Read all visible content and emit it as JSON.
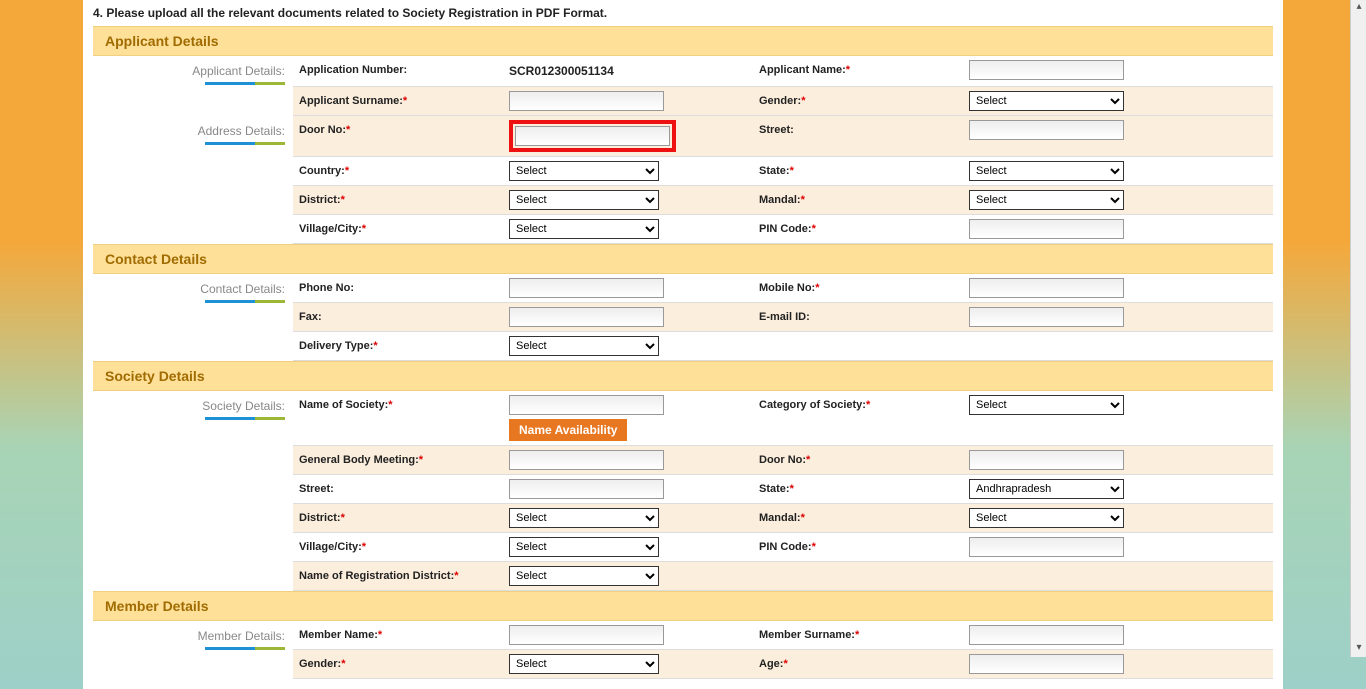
{
  "instruction": "4. Please upload all the relevant documents related to Society Registration in PDF Format.",
  "sections": {
    "applicant": {
      "title": "Applicant Details",
      "sidebars": {
        "applicant": "Applicant Details:",
        "address": "Address Details:"
      },
      "fields": {
        "application_number_label": "Application Number:",
        "application_number_value": "SCR012300051134",
        "applicant_name_label": "Applicant Name:",
        "applicant_surname_label": "Applicant Surname:",
        "gender_label": "Gender:",
        "door_no_label": "Door No:",
        "street_label": "Street:",
        "country_label": "Country:",
        "state_label": "State:",
        "district_label": "District:",
        "mandal_label": "Mandal:",
        "village_label": "Village/City:",
        "pin_label": "PIN Code:"
      }
    },
    "contact": {
      "title": "Contact Details",
      "sidebar": "Contact Details:",
      "fields": {
        "phone_label": "Phone No:",
        "mobile_label": "Mobile No:",
        "fax_label": "Fax:",
        "email_label": "E-mail ID:",
        "delivery_label": "Delivery Type:"
      }
    },
    "society": {
      "title": "Society Details",
      "sidebar": "Society Details:",
      "fields": {
        "name_label": "Name of  Society:",
        "name_avail_btn": "Name Availability",
        "category_label": "Category of Society:",
        "gbm_label": "General Body Meeting:",
        "door_no_label": "Door No:",
        "street_label": "Street:",
        "state_label": "State:",
        "state_value": "Andhrapradesh",
        "district_label": "District:",
        "mandal_label": "Mandal:",
        "village_label": "Village/City:",
        "pin_label": "PIN Code:",
        "reg_dist_label": "Name of Registration District:"
      }
    },
    "member": {
      "title": "Member Details",
      "sidebar": "Member Details:",
      "fields": {
        "member_name_label": "Member Name:",
        "member_surname_label": "Member Surname:",
        "gender_label": "Gender:",
        "age_label": "Age:"
      }
    }
  },
  "options": {
    "select": "Select"
  }
}
